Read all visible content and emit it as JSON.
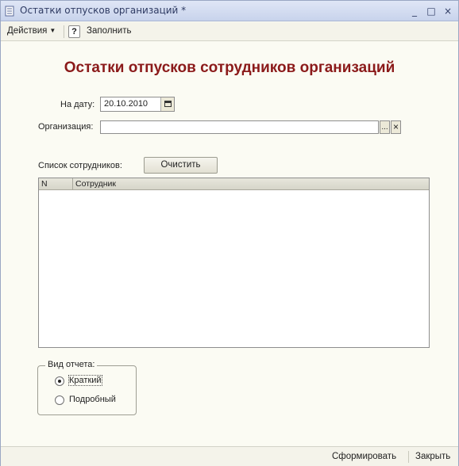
{
  "window": {
    "title": "Остатки отпусков организаций *",
    "minimize_glyph": "_",
    "maximize_glyph": "□",
    "close_glyph": "×"
  },
  "toolbar": {
    "actions_label": "Действия",
    "help_glyph": "?",
    "fill_label": "Заполнить"
  },
  "form": {
    "heading": "Остатки отпусков сотрудников организаций",
    "date_label": "На дату:",
    "date_value": "20.10.2010",
    "org_label": "Организация:",
    "org_value": "",
    "org_select_glyph": "...",
    "org_clear_glyph": "×",
    "employees_label": "Список сотрудников:",
    "clear_button": "Очистить",
    "table_headers": [
      "N",
      "Сотрудник"
    ],
    "table_rows": []
  },
  "report_type": {
    "title": "Вид отчета:",
    "options": [
      "Краткий",
      "Подробный"
    ],
    "selected": "Краткий"
  },
  "footer": {
    "generate_label": "Сформировать",
    "close_label": "Закрыть"
  }
}
